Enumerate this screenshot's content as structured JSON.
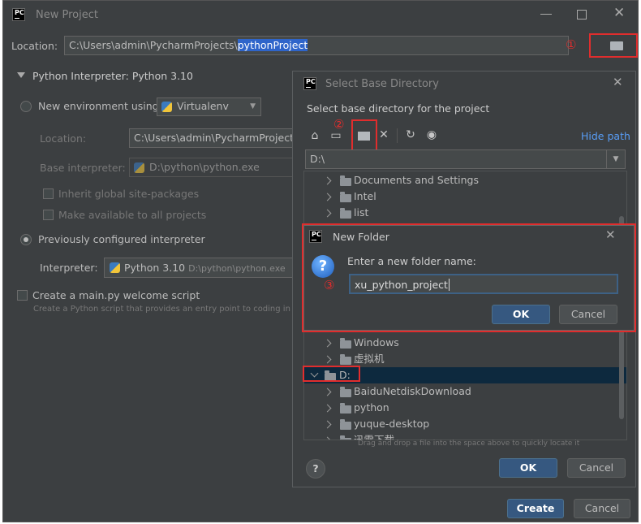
{
  "main_window": {
    "title": "New Project",
    "logo_text": "PC",
    "location_label": "Location:",
    "location_prefix": "C:\\Users\\admin\\PycharmProjects\\",
    "location_selected": "pythonProject",
    "annotation_1": "①",
    "interpreter_section": "Python Interpreter: Python 3.10",
    "new_env_label": "New environment using",
    "env_tool": "Virtualenv",
    "sub_location_label": "Location:",
    "sub_location_value": "C:\\Users\\admin\\PycharmProjects\\p",
    "base_interp_label": "Base interpreter:",
    "base_interp_value": "D:\\python\\python.exe",
    "inherit_label": "Inherit global site-packages",
    "make_available_label": "Make available to all projects",
    "prev_config_label": "Previously configured interpreter",
    "interpreter_label": "Interpreter:",
    "interpreter_value": "Python 3.10",
    "interpreter_path": "D:\\python\\python.exe",
    "create_main_label": "Create a main.py welcome script",
    "create_main_desc": "Create a Python script that provides an entry point to coding in Py",
    "create_button": "Create",
    "cancel_button": "Cancel"
  },
  "select_dir": {
    "title": "Select Base Directory",
    "description": "Select base directory for the project",
    "annotation_2": "②",
    "hide_path": "Hide path",
    "path_value": "D:\\",
    "tree_items": [
      "Documents and Settings",
      "Intel",
      "list",
      "Windows",
      "虚拟机"
    ],
    "drive_label": "D:",
    "drive_children": [
      "BaiduNetdiskDownload",
      "python",
      "yuque-desktop",
      "迅雷下载"
    ],
    "drag_hint": "Drag and drop a file into the space above to quickly locate it",
    "ok_button": "OK",
    "cancel_button": "Cancel",
    "help_icon_text": "?"
  },
  "new_folder": {
    "title": "New Folder",
    "prompt": "Enter a new folder name:",
    "annotation_3": "③",
    "input_value": "xu_python_project",
    "ok_button": "OK",
    "cancel_button": "Cancel",
    "question_glyph": "?"
  },
  "colors": {
    "background": "#3c3f41",
    "field": "#45494a",
    "selection": "#2f65ca",
    "primary_button": "#365880",
    "annotation_red": "#e12d2d"
  }
}
